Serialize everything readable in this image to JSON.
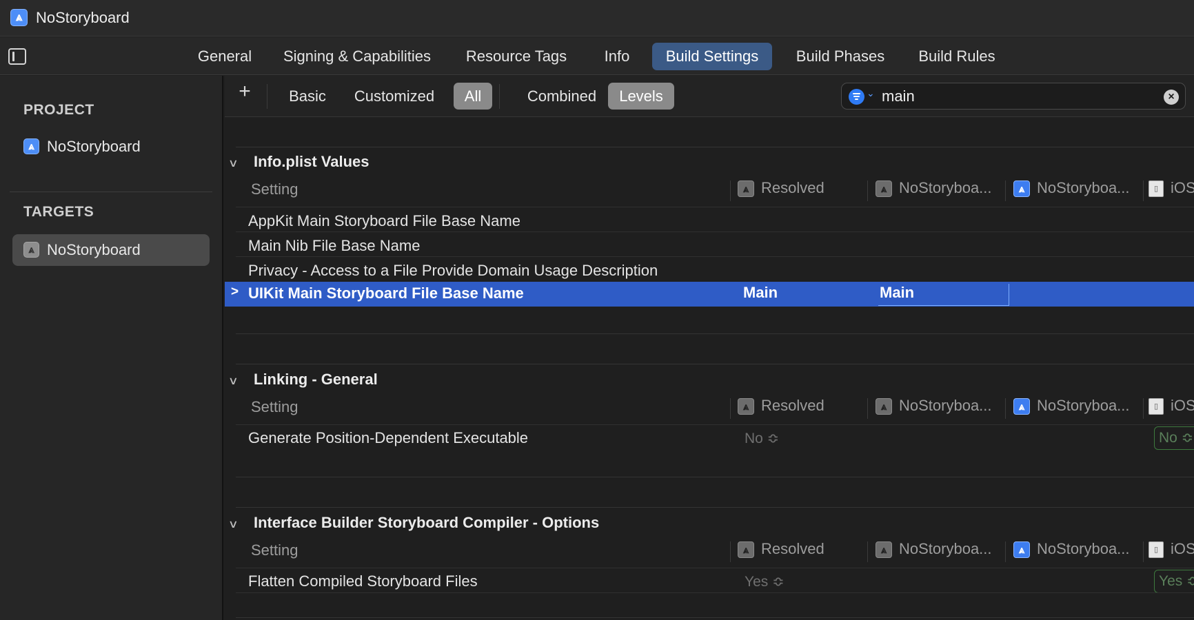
{
  "window": {
    "project_name": "NoStoryboard"
  },
  "tabs": [
    {
      "label": "General",
      "active": false
    },
    {
      "label": "Signing & Capabilities",
      "active": false
    },
    {
      "label": "Resource Tags",
      "active": false
    },
    {
      "label": "Info",
      "active": false
    },
    {
      "label": "Build Settings",
      "active": true
    },
    {
      "label": "Build Phases",
      "active": false
    },
    {
      "label": "Build Rules",
      "active": false
    }
  ],
  "sidebar": {
    "project_header": "PROJECT",
    "project_item": "NoStoryboard",
    "targets_header": "TARGETS",
    "target_item": "NoStoryboard"
  },
  "filterbar": {
    "add_icon": "plus-icon",
    "segments": [
      "Basic",
      "Customized",
      "All",
      "Combined",
      "Levels"
    ],
    "active_filter": "All",
    "active_view": "Levels",
    "search_value": "main"
  },
  "columns": {
    "setting": "Setting",
    "resolved": "Resolved",
    "target": "NoStoryboa...",
    "project": "NoStoryboa...",
    "ios": "iOS"
  },
  "sections": [
    {
      "title": "Info.plist Values",
      "rows": [
        "AppKit Main Storyboard File Base Name",
        "Main Nib File Base Name",
        "Privacy - Access to a File Provide Domain Usage Description"
      ],
      "selected_row": {
        "label": "UIKit Main Storyboard File Base Name",
        "resolved": "Main",
        "target": "Main"
      }
    },
    {
      "title": "Linking - General",
      "row": {
        "label": "Generate Position-Dependent Executable",
        "resolved": "No ≎",
        "ios": "No ≎"
      }
    },
    {
      "title": "Interface Builder Storyboard Compiler - Options",
      "row": {
        "label": "Flatten Compiled Storyboard Files",
        "resolved": "Yes ≎",
        "ios": "Yes ≎"
      }
    }
  ],
  "colors": {
    "selection": "#2f5cc6",
    "active_tab": "#3b5a86",
    "accent": "#2f7bf5"
  }
}
